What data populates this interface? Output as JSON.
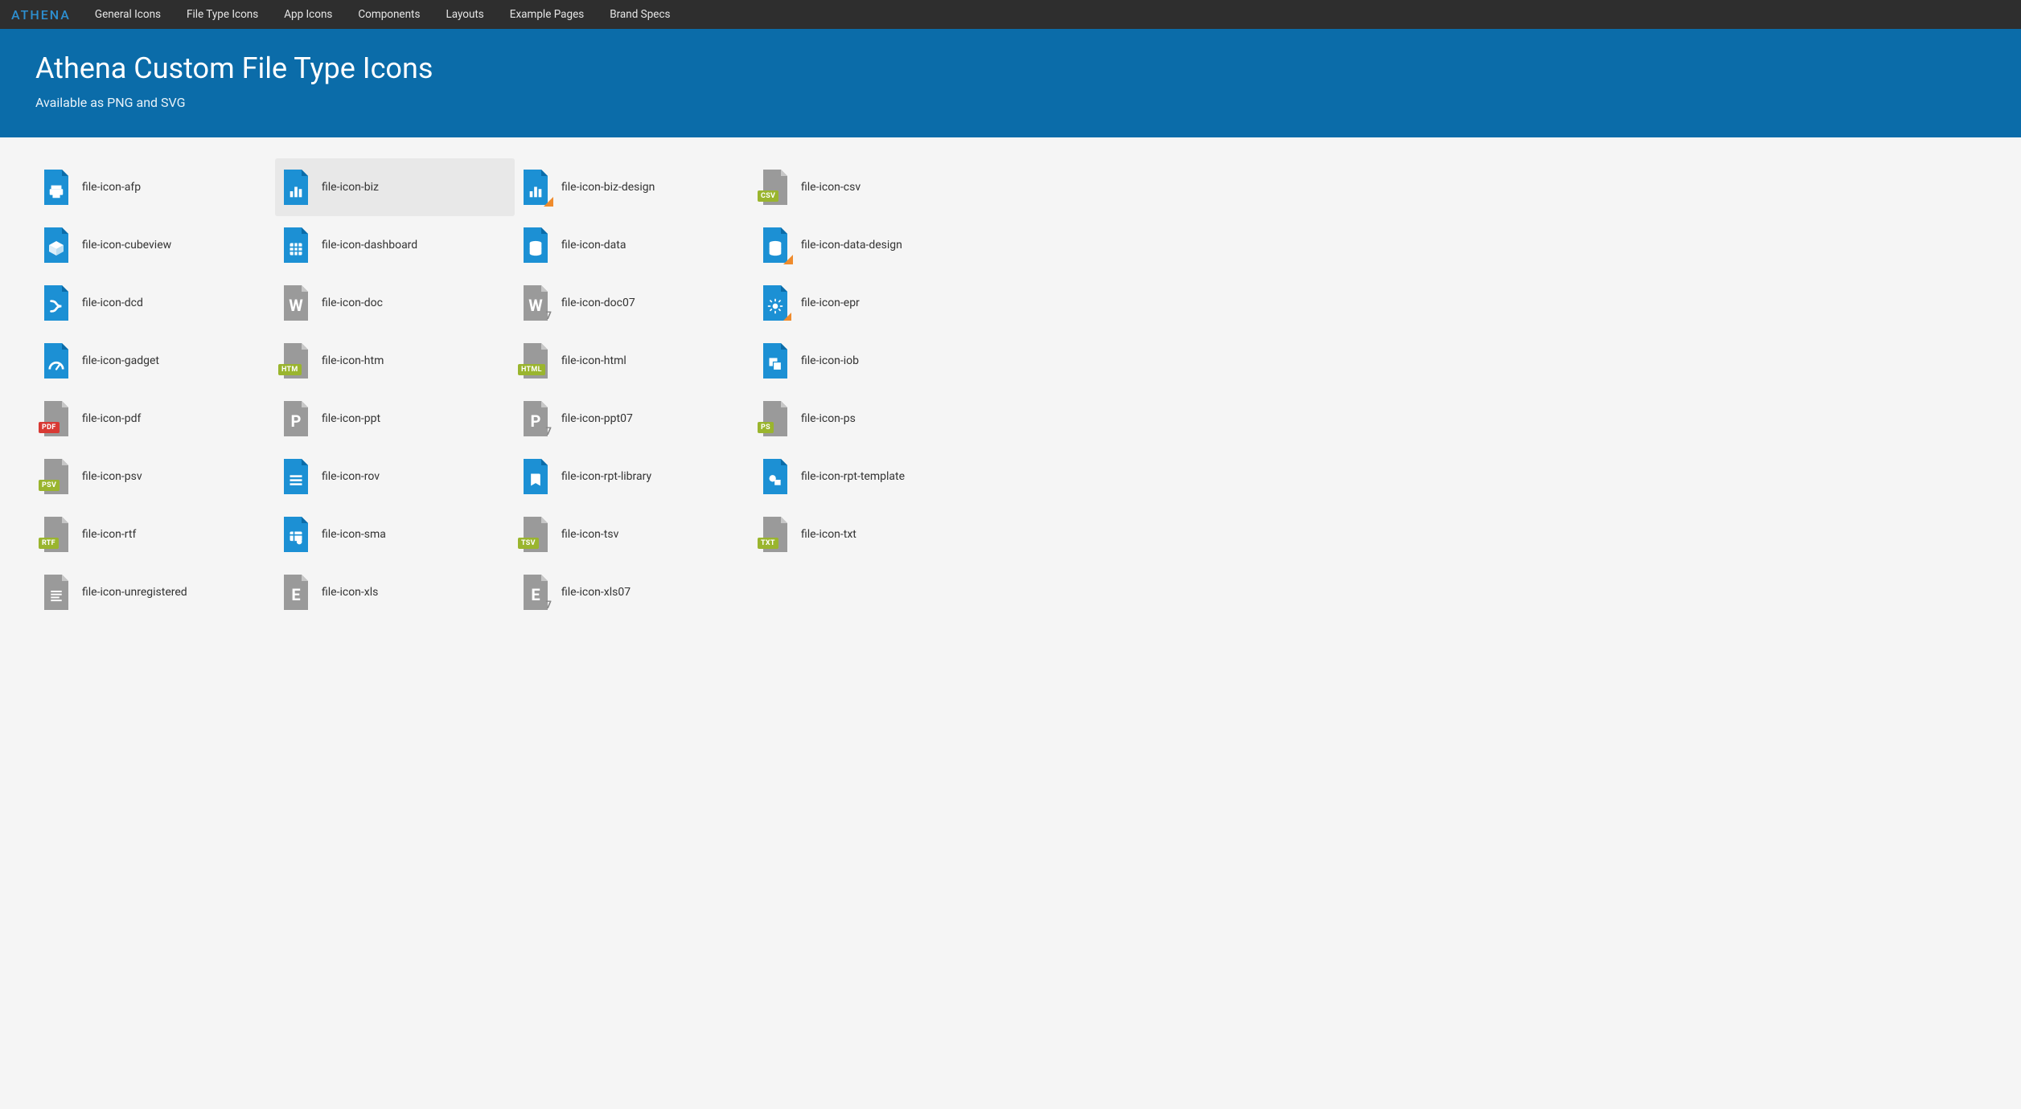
{
  "brand": "ATHENA",
  "nav": [
    "General Icons",
    "File Type Icons",
    "App Icons",
    "Components",
    "Layouts",
    "Example Pages",
    "Brand Specs"
  ],
  "hero": {
    "title": "Athena Custom File Type Icons",
    "subtitle": "Available as PNG and SVG"
  },
  "colors": {
    "blue": "#1c90d4",
    "darkblue": "#0b6ca9",
    "gray": "#9a9a9a",
    "orange": "#ef8b2c",
    "red": "#d83a34",
    "olive": "#9ab52e"
  },
  "hoverIndex": 1,
  "icons": [
    {
      "name": "file-icon-afp",
      "base": "blue",
      "glyph": "printer"
    },
    {
      "name": "file-icon-biz",
      "base": "blue",
      "glyph": "bars"
    },
    {
      "name": "file-icon-biz-design",
      "base": "blue",
      "glyph": "bars",
      "triangle": true
    },
    {
      "name": "file-icon-csv",
      "base": "gray",
      "badge": "CSV",
      "badgeColor": "olive"
    },
    {
      "name": "file-icon-cubeview",
      "base": "blue",
      "glyph": "cube"
    },
    {
      "name": "file-icon-dashboard",
      "base": "blue",
      "glyph": "grid"
    },
    {
      "name": "file-icon-data",
      "base": "blue",
      "glyph": "db"
    },
    {
      "name": "file-icon-data-design",
      "base": "blue",
      "glyph": "db",
      "triangle": true
    },
    {
      "name": "file-icon-dcd",
      "base": "blue",
      "glyph": "flow"
    },
    {
      "name": "file-icon-doc",
      "base": "gray",
      "letter": "W"
    },
    {
      "name": "file-icon-doc07",
      "base": "gray",
      "letter": "W",
      "seven": true
    },
    {
      "name": "file-icon-epr",
      "base": "blue",
      "glyph": "gear",
      "triangle": "small"
    },
    {
      "name": "file-icon-gadget",
      "base": "blue",
      "glyph": "gauge"
    },
    {
      "name": "file-icon-htm",
      "base": "gray",
      "badge": "HTM",
      "badgeColor": "olive"
    },
    {
      "name": "file-icon-html",
      "base": "gray",
      "badge": "HTML",
      "badgeColor": "olive"
    },
    {
      "name": "file-icon-iob",
      "base": "blue",
      "glyph": "overlap"
    },
    {
      "name": "file-icon-pdf",
      "base": "gray",
      "badge": "PDF",
      "badgeColor": "red"
    },
    {
      "name": "file-icon-ppt",
      "base": "gray",
      "letter": "P"
    },
    {
      "name": "file-icon-ppt07",
      "base": "gray",
      "letter": "P",
      "seven": true
    },
    {
      "name": "file-icon-ps",
      "base": "gray",
      "badge": "PS",
      "badgeColor": "olive"
    },
    {
      "name": "file-icon-psv",
      "base": "gray",
      "badge": "PSV",
      "badgeColor": "olive"
    },
    {
      "name": "file-icon-rov",
      "base": "blue",
      "glyph": "lines"
    },
    {
      "name": "file-icon-rpt-library",
      "base": "blue",
      "glyph": "book"
    },
    {
      "name": "file-icon-rpt-template",
      "base": "blue",
      "glyph": "shape"
    },
    {
      "name": "file-icon-rtf",
      "base": "gray",
      "badge": "RTF",
      "badgeColor": "olive"
    },
    {
      "name": "file-icon-sma",
      "base": "blue",
      "glyph": "table"
    },
    {
      "name": "file-icon-tsv",
      "base": "gray",
      "badge": "TSV",
      "badgeColor": "olive"
    },
    {
      "name": "file-icon-txt",
      "base": "gray",
      "badge": "TXT",
      "badgeColor": "olive"
    },
    {
      "name": "file-icon-unregistered",
      "base": "gray",
      "glyph": "doclines"
    },
    {
      "name": "file-icon-xls",
      "base": "gray",
      "letter": "E"
    },
    {
      "name": "file-icon-xls07",
      "base": "gray",
      "letter": "E",
      "seven": true
    }
  ]
}
